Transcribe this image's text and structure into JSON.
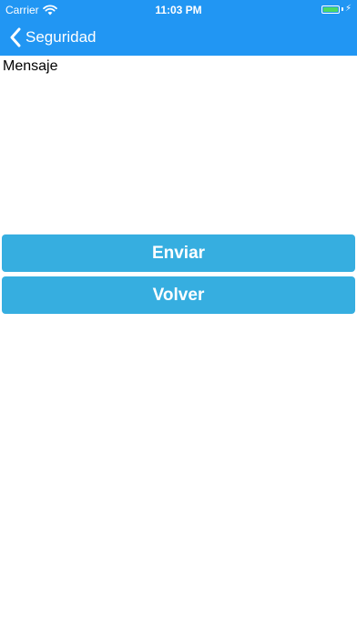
{
  "status_bar": {
    "carrier": "Carrier",
    "time": "11:03 PM",
    "battery_level": 1.0,
    "battery_color": "#4cd964",
    "icons": [
      "wifi-icon",
      "battery-icon",
      "charging-bolt-icon"
    ]
  },
  "nav": {
    "back_label": "Seguridad",
    "back_icon": "chevron-left-icon",
    "bar_color": "#2196f3"
  },
  "content": {
    "message_label": "Mensaje"
  },
  "buttons": {
    "send_label": "Enviar",
    "back_label": "Volver",
    "color": "#36aee0"
  }
}
